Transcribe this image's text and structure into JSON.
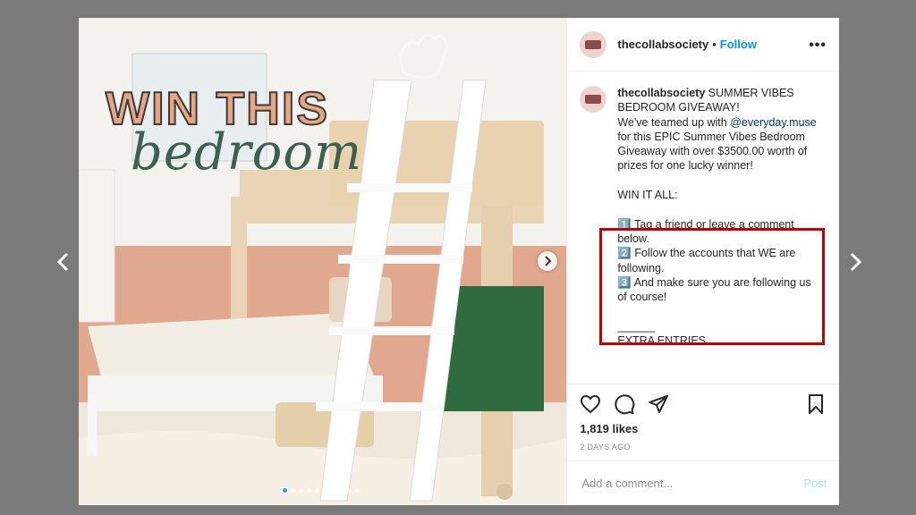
{
  "colors": {
    "overlay": "#7a7a7a",
    "link": "#0095f6",
    "highlight": "#c00000"
  },
  "nav": {
    "prev_icon": "chevron-left-icon",
    "next_icon": "chevron-right-icon"
  },
  "media": {
    "headline": "WIN THIS",
    "script_word": "bedroom",
    "slide_count": 10,
    "active_slide": 1
  },
  "header": {
    "username": "thecollabsociety",
    "separator": "•",
    "follow_label": "Follow",
    "more_label": "•••"
  },
  "caption": {
    "username": "thecollabsociety",
    "intro": " SUMMER VIBES BEDROOM GIVEAWAY!",
    "line2": "We've teamed up with ",
    "mention": "@everyday.muse",
    "line3": " for this EPIC Summer Vibes Bedroom Giveaway with over $3500.00 worth of prizes for one lucky winner!",
    "section": "WIN IT ALL:",
    "step1": "1️⃣ Tag a friend or leave a comment below.",
    "step2": "2️⃣ Follow the accounts that WE are following.",
    "step3": "3️⃣ And make sure you are following us of course!",
    "divider": "______",
    "extra": "EXTRA ENTRIES"
  },
  "actions": {
    "likes": "1,819 likes",
    "time": "2 DAYS AGO"
  },
  "comment": {
    "placeholder": "Add a comment...",
    "post_label": "Post"
  }
}
